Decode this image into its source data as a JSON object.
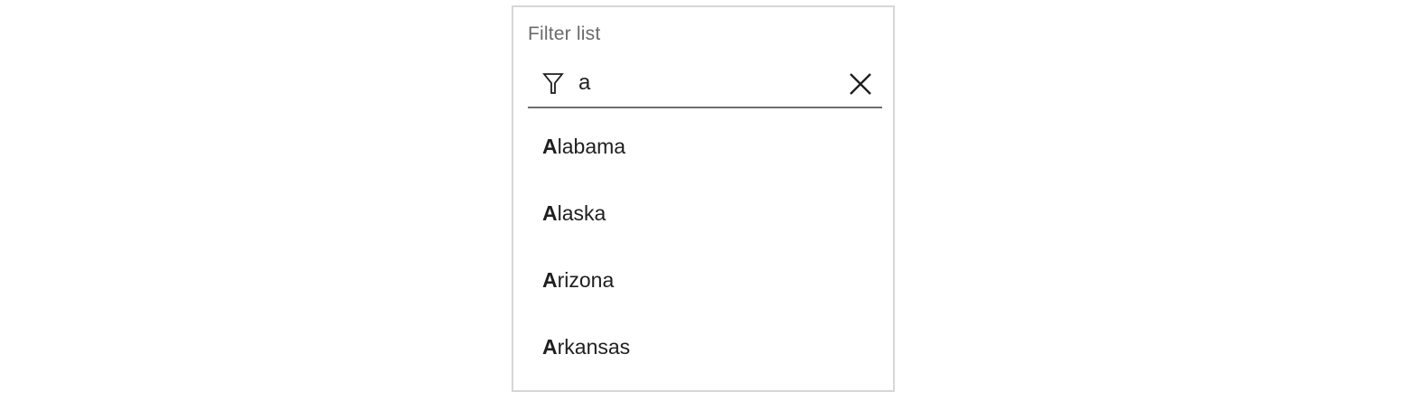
{
  "filter": {
    "label": "Filter list",
    "value": "a",
    "icon": "filter-icon",
    "clear_icon": "close-icon"
  },
  "options": [
    {
      "match": "A",
      "rest": "labama"
    },
    {
      "match": "A",
      "rest": "laska"
    },
    {
      "match": "A",
      "rest": "rizona"
    },
    {
      "match": "A",
      "rest": "rkansas"
    }
  ],
  "colors": {
    "border": "#d6d6d6",
    "label": "#6b6b6b",
    "underline": "#6e6e6e",
    "text": "#1f1f1f"
  }
}
